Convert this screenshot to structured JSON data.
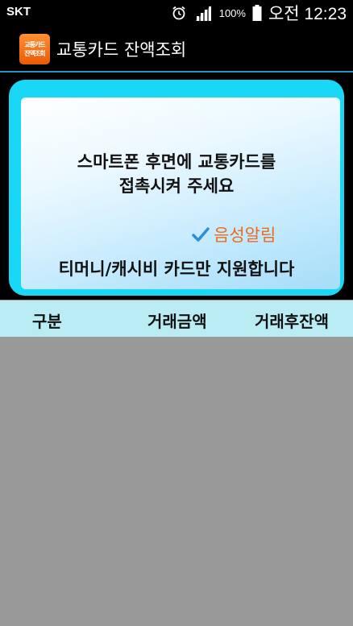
{
  "status_bar": {
    "carrier": "SKT",
    "battery_percent": "100%",
    "time": "오전 12:23"
  },
  "app_bar": {
    "logo_line1": "교통카드",
    "logo_line2": "잔액조회",
    "title": "교통카드 잔액조회"
  },
  "prompt": {
    "line1": "스마트폰 후면에 교통카드를",
    "line2": "접촉시켜 주세요"
  },
  "voice_alert": {
    "label": "음성알림",
    "checked": true
  },
  "support_text": "티머니/캐시비 카드만 지원합니다",
  "table": {
    "columns": [
      "구분",
      "거래금액",
      "거래후잔액"
    ],
    "rows": []
  },
  "colors": {
    "frame": "#18d8f6",
    "accent_orange": "#ef6a1c",
    "table_header": "#b9ecf3",
    "list_bg": "#999999"
  }
}
